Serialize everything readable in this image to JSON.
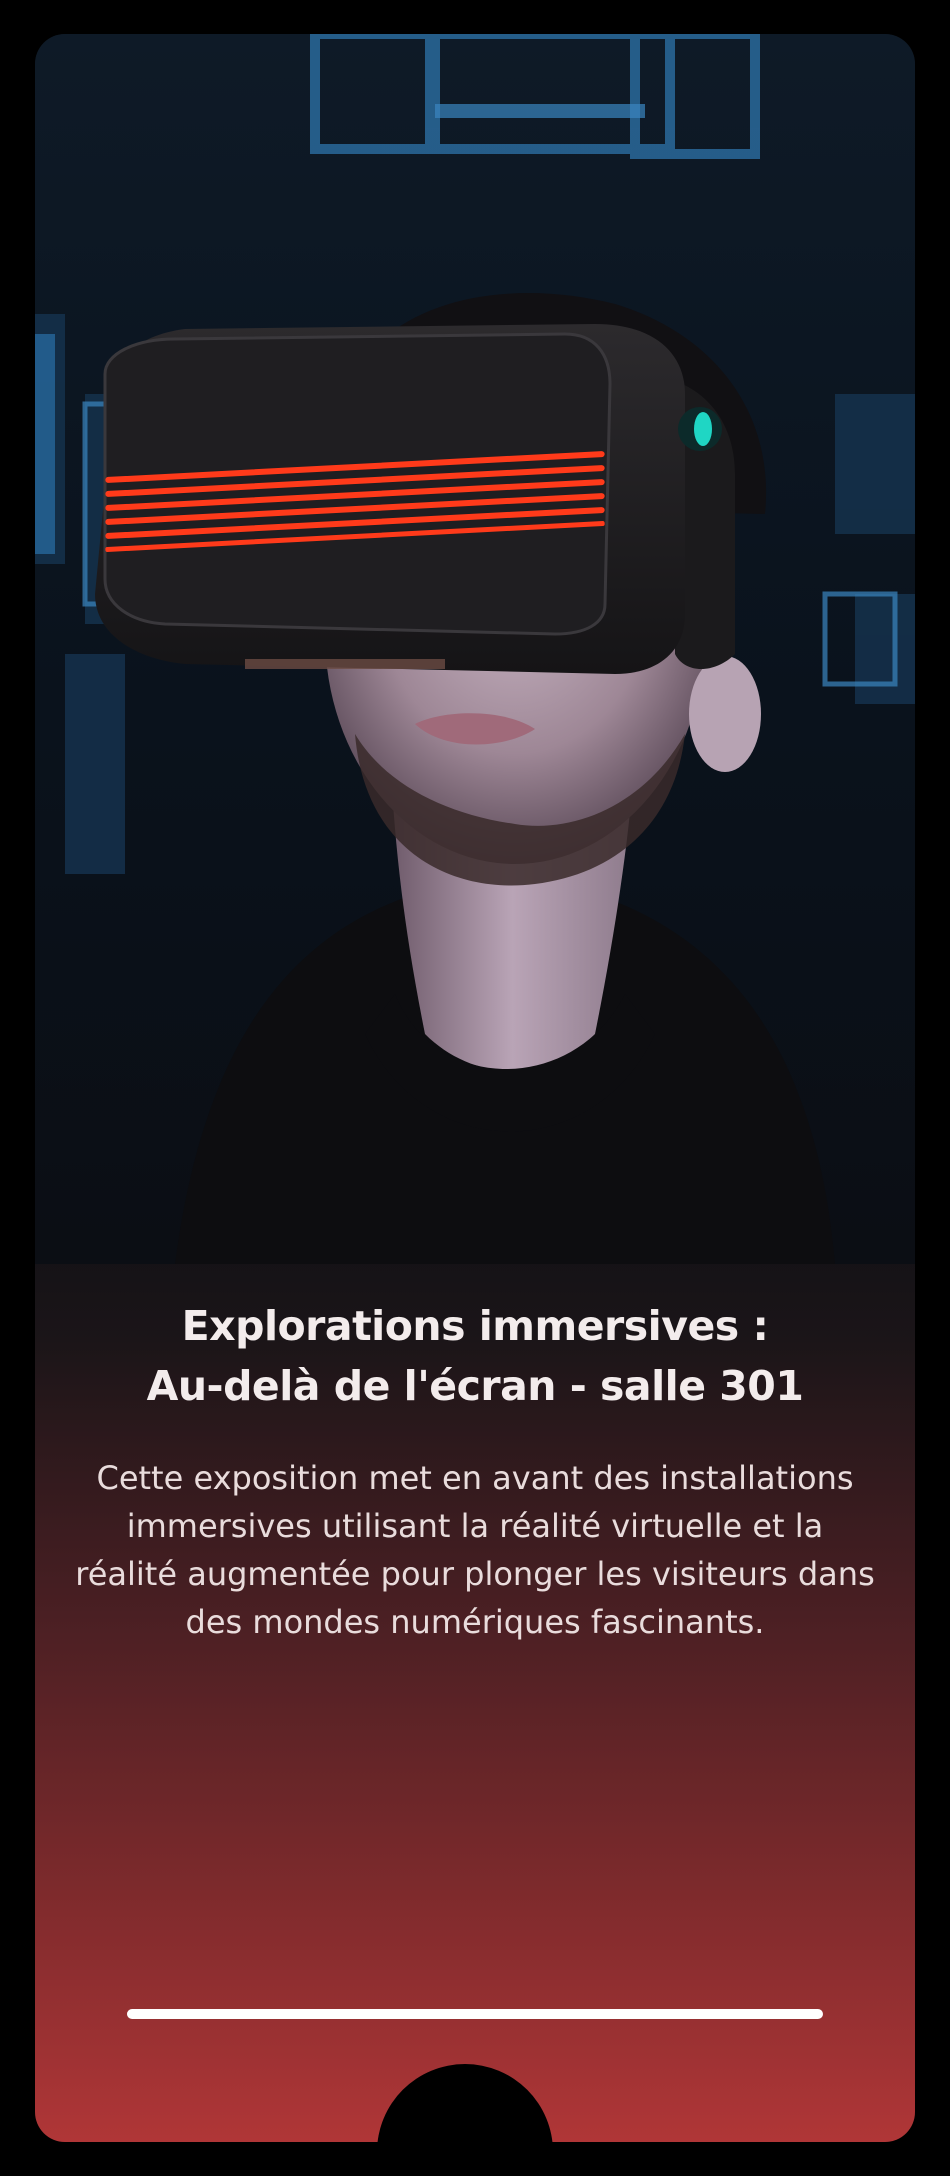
{
  "hero": {
    "image": "person-wearing-vr-headset-photo"
  },
  "exhibit": {
    "title_line1": "Explorations immersives :",
    "title_line2": "Au-delà de l'écran - salle 301",
    "description": "Cette exposition met en avant des installations immersives utilisant la réalité virtuelle et la réalité augmentée pour plonger les visiteurs dans des mondes numériques fascinants."
  },
  "colors": {
    "accent": "#b03637",
    "background": "#000000",
    "headset_light": "#ff3a1a",
    "sensor": "#1fd6c4"
  }
}
